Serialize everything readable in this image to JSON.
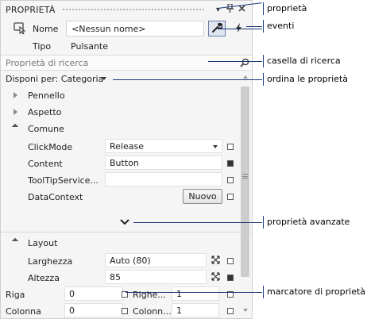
{
  "panel": {
    "title": "PROPRIETÀ",
    "pin_glyph": "⸸",
    "close_glyph": "✕",
    "name_label": "Nome",
    "name_value": "<Nessun nome>",
    "type_label": "Tipo",
    "type_value": "Pulsante",
    "search_placeholder": "Proprietà di ricerca",
    "arrange_label": "Disponi per: Categoria"
  },
  "categories": {
    "pennello": "Pennello",
    "aspetto": "Aspetto",
    "comune": "Comune",
    "layout": "Layout"
  },
  "comune_props": [
    {
      "name": "ClickMode",
      "value": "Release"
    },
    {
      "name": "Content",
      "value": "Button"
    },
    {
      "name": "ToolTipService...",
      "value": ""
    },
    {
      "name": "DataContext",
      "button": "Nuovo"
    }
  ],
  "layout_props": [
    {
      "name": "Larghezza",
      "value": "Auto (80)"
    },
    {
      "name": "Altezza",
      "value": "85"
    },
    {
      "name": "Riga",
      "value": "0",
      "name2": "Righe...",
      "value2": "1"
    },
    {
      "name": "Colonna",
      "value": "0",
      "name2": "Colonn...",
      "value2": "1"
    }
  ],
  "callouts": {
    "properties": "proprietà",
    "events": "eventi",
    "search_box": "casella di ricerca",
    "sort": "ordina le proprietà",
    "advanced": "proprietà avanzate",
    "marker": "marcatore di proprietà"
  },
  "colors": {
    "panel_bg": "#f5f5f5",
    "callout_line": "#1a3a7a",
    "active_button": "#dfe6f1"
  }
}
